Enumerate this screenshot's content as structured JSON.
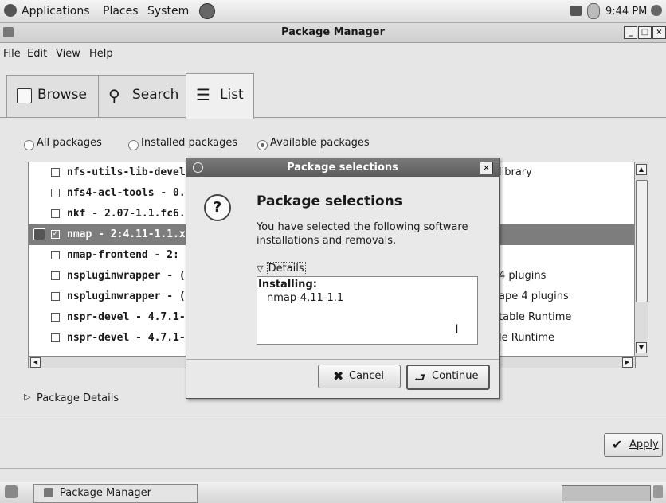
{
  "top_panel": {
    "menus": [
      "Applications",
      "Places",
      "System"
    ],
    "clock": "9:44 PM"
  },
  "window": {
    "title": "Package Manager",
    "menu": [
      "File",
      "Edit",
      "View",
      "Help"
    ],
    "tabs": [
      {
        "label": "Browse",
        "icon": "browse-icon",
        "active": false
      },
      {
        "label": "Search",
        "icon": "search-icon",
        "active": false
      },
      {
        "label": "List",
        "icon": "list-icon",
        "active": true
      }
    ],
    "filters": [
      {
        "label": "All packages",
        "selected": false
      },
      {
        "label": "Installed packages",
        "selected": false
      },
      {
        "label": "Available packages",
        "selected": true
      }
    ],
    "packages": [
      {
        "name": "nfs-utils-lib-devel -",
        "desc": "library",
        "checked": false,
        "selected": false
      },
      {
        "name": "nfs4-acl-tools - 0.3",
        "desc": "",
        "checked": false,
        "selected": false
      },
      {
        "name": "nkf - 2.07-1.1.fc6.x",
        "desc": "",
        "checked": false,
        "selected": false
      },
      {
        "name": "nmap - 2:4.11-1.1.x",
        "desc": "",
        "checked": true,
        "selected": true
      },
      {
        "name": "nmap-frontend - 2:",
        "desc": "",
        "checked": false,
        "selected": false
      },
      {
        "name": "nspluginwrapper - (",
        "desc": "4 plugins",
        "checked": false,
        "selected": false
      },
      {
        "name": "nspluginwrapper - (",
        "desc": "ape 4 plugins",
        "checked": false,
        "selected": false
      },
      {
        "name": "nspr-devel - 4.7.1-1",
        "desc": "table Runtime",
        "checked": false,
        "selected": false
      },
      {
        "name": "nspr-devel - 4.7.1-1",
        "desc": "le Runtime",
        "checked": false,
        "selected": false
      }
    ],
    "package_details_label": "Package Details",
    "apply_label": "Apply"
  },
  "dialog": {
    "title": "Package selections",
    "heading": "Package selections",
    "text": "You have selected the following software installations and removals.",
    "details_label": "Details",
    "installing_label": "Installing:",
    "installing_items": [
      "nmap-4.11-1.1"
    ],
    "cancel_label": "Cancel",
    "continue_label": "Continue"
  },
  "taskbar": {
    "task_label": "Package Manager"
  }
}
